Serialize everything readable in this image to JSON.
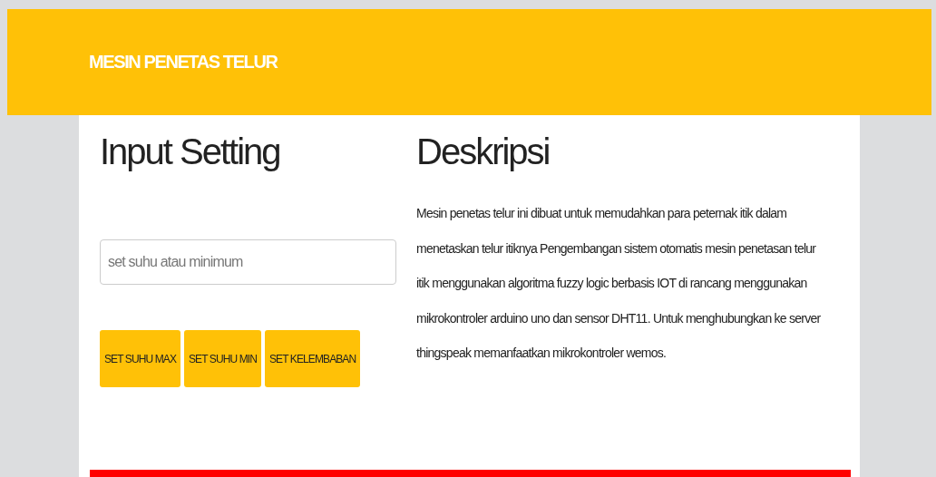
{
  "header": {
    "title": "MESIN PENETAS TELUR"
  },
  "input_setting": {
    "heading": "Input Setting",
    "field": {
      "placeholder": "set suhu atau minimum"
    },
    "buttons": [
      "SET SUHU MAX",
      "SET SUHU MIN",
      "SET KELEMBABAN"
    ]
  },
  "description": {
    "heading": "Deskripsi",
    "text": "Mesin penetas telur ini dibuat untuk memudahkan para peternak itik dalam menetaskan telur itiknya Pengembangan sistem otomatis mesin penetasan telur itik menggunakan algoritma fuzzy logic berbasis IOT di rancang menggunakan mikrokontroler arduino uno dan sensor DHT11. Untuk menghubungkan ke server thingspeak memanfaatkan mikrokontroler wemos."
  }
}
